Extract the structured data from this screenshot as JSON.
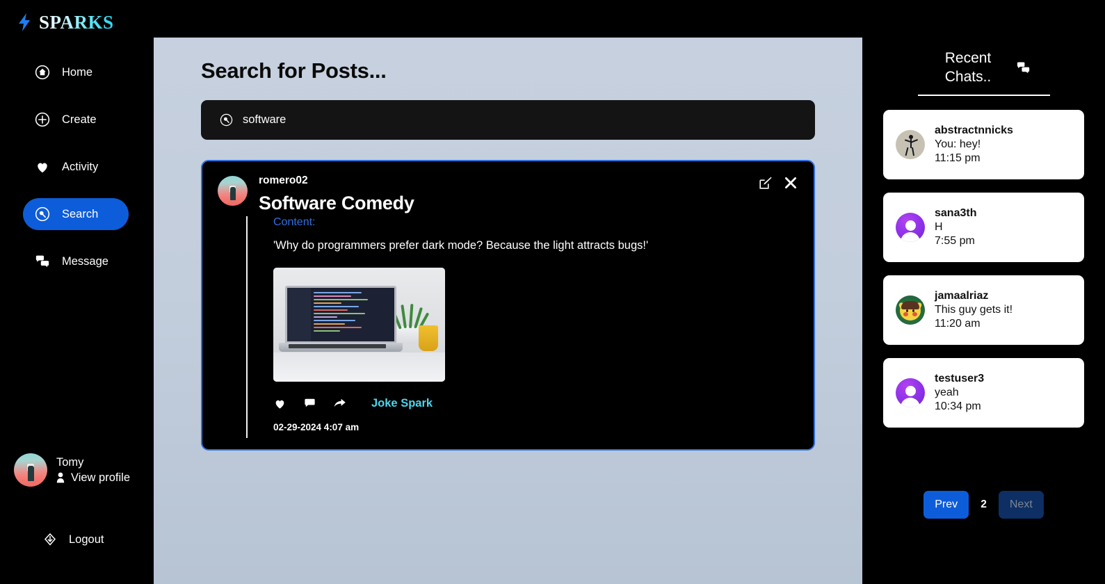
{
  "brand": {
    "name": "SPARKS",
    "bolt_icon": "lightning-bolt-icon",
    "accent": "#28d8f5"
  },
  "sidebar": {
    "items": [
      {
        "label": "Home",
        "icon": "home-circle-icon",
        "active": false
      },
      {
        "label": "Create",
        "icon": "plus-circle-icon",
        "active": false
      },
      {
        "label": "Activity",
        "icon": "heart-icon",
        "active": false,
        "badge_icon": "bell-notification-icon",
        "badge_color": "#f01b1b"
      },
      {
        "label": "Search",
        "icon": "search-circle-icon",
        "active": true
      },
      {
        "label": "Message",
        "icon": "chat-bubbles-icon",
        "active": false
      }
    ],
    "active_color": "#0d5ddb",
    "profile": {
      "name": "Tomy",
      "view_profile_label": "View profile",
      "person_icon": "person-icon",
      "avatar": "user-avatar"
    },
    "logout": {
      "label": "Logout",
      "icon": "logout-icon"
    }
  },
  "main": {
    "title": "Search for Posts...",
    "search": {
      "value": "software",
      "placeholder": "Search",
      "icon": "search-circle-icon"
    },
    "post": {
      "username": "romero02",
      "title": "Software Comedy",
      "content_label": "Content:",
      "content_text": "'Why do programmers prefer dark mode? Because the light attracts bugs!'",
      "image_alt": "laptop-with-code-photo",
      "edit_icon": "edit-pencil-icon",
      "close_icon": "close-x-icon",
      "actions": [
        {
          "icon": "heart-icon",
          "name": "like-button"
        },
        {
          "icon": "comment-bubble-icon",
          "name": "comment-button"
        },
        {
          "icon": "share-arrow-icon",
          "name": "share-button"
        }
      ],
      "spark_tag": "Joke Spark",
      "date": "02-29-2024 4:07 am",
      "border_color": "#2f6fe0"
    }
  },
  "rightbar": {
    "title": "Recent Chats..",
    "message_icon": "chat-bubbles-icon",
    "chats": [
      {
        "user": "abstractnnicks",
        "message": "You: hey!",
        "time": "11:15 pm",
        "avatar": "stick-figure-avatar"
      },
      {
        "user": "sana3th",
        "message": "H",
        "time": "7:55 pm",
        "avatar": "default-purple-avatar"
      },
      {
        "user": "jamaalriaz",
        "message": "This guy gets it!",
        "time": "11:20 am",
        "avatar": "pikachu-avatar"
      },
      {
        "user": "testuser3",
        "message": "yeah",
        "time": "10:34 pm",
        "avatar": "default-purple-avatar"
      }
    ],
    "pagination": {
      "prev_label": "Prev",
      "page": "2",
      "next_label": "Next",
      "next_disabled": true
    }
  }
}
